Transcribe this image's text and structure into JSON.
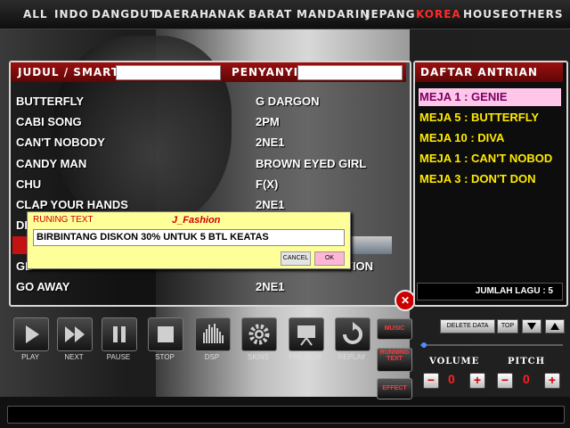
{
  "categories": [
    {
      "label": "ALL",
      "active": false
    },
    {
      "label": "INDO",
      "active": false
    },
    {
      "label": "DANGDUT",
      "active": false
    },
    {
      "label": "DAERAH",
      "active": false
    },
    {
      "label": "ANAK",
      "active": false
    },
    {
      "label": "BARAT",
      "active": false
    },
    {
      "label": "MANDARIN",
      "active": false
    },
    {
      "label": "JEPANG",
      "active": false
    },
    {
      "label": "KOREA",
      "active": true
    },
    {
      "label": "HOUSE",
      "active": false
    },
    {
      "label": "OTHERS",
      "active": false
    }
  ],
  "songlist": {
    "title_label": "JUDUL / SMART",
    "title_search_value": "",
    "artist_label": "PENYANYI",
    "artist_search_value": "",
    "rows": [
      {
        "title": "BUTTERFLY",
        "artist": "G DARGON"
      },
      {
        "title": "CABI SONG",
        "artist": "2PM"
      },
      {
        "title": "CAN'T NOBODY",
        "artist": "2NE1"
      },
      {
        "title": "CANDY MAN",
        "artist": "BROWN EYED GIRL"
      },
      {
        "title": "CHU",
        "artist": "F(X)"
      },
      {
        "title": "CLAP YOUR HANDS",
        "artist": "2NE1"
      },
      {
        "title": "DI",
        "artist": ""
      },
      {
        "title": "",
        "artist": ""
      },
      {
        "title": "GE",
        "artist": "TION"
      },
      {
        "title": "GO AWAY",
        "artist": "2NE1"
      }
    ]
  },
  "queue": {
    "title": "DAFTAR ANTRIAN",
    "items": [
      {
        "text": "MEJA 1 : GENIE",
        "active": true
      },
      {
        "text": "MEJA 5 : BUTTERFLY",
        "active": false
      },
      {
        "text": "MEJA 10 : DIVA",
        "active": false
      },
      {
        "text": "MEJA 1 : CAN'T NOBOD",
        "active": false
      },
      {
        "text": "MEJA 3 : DON'T DON",
        "active": false
      }
    ],
    "count_text": "JUMLAH LAGU : 5"
  },
  "dialog": {
    "title": "RUNING TEXT",
    "brand": "J_Fashion",
    "input_value": "BIRBINTANG DISKON 30% UNTUK 5 BTL KEATAS",
    "cancel_label": "CANCEL",
    "ok_label": "OK"
  },
  "controls": {
    "play": "PLAY",
    "next": "NEXT",
    "pause": "PAUSE",
    "stop": "STOP",
    "dsp": "DSP",
    "skins": "SKINS",
    "preview": "PREVIEW",
    "replay": "REPLAY",
    "music": "MUSIC",
    "running_text_1": "RUNNING",
    "running_text_2": "TEXT",
    "effect": "EFFECT",
    "delete_data": "DELETE DATA",
    "top": "TOP",
    "volume_label": "VOLUME",
    "volume_value": "0",
    "pitch_label": "PITCH",
    "pitch_value": "0"
  },
  "colors": {
    "accent_red": "#c21212",
    "queue_text": "#ffea00",
    "queue_active_bg": "#ffc6ea",
    "dialog_bg": "#ffff9a"
  }
}
